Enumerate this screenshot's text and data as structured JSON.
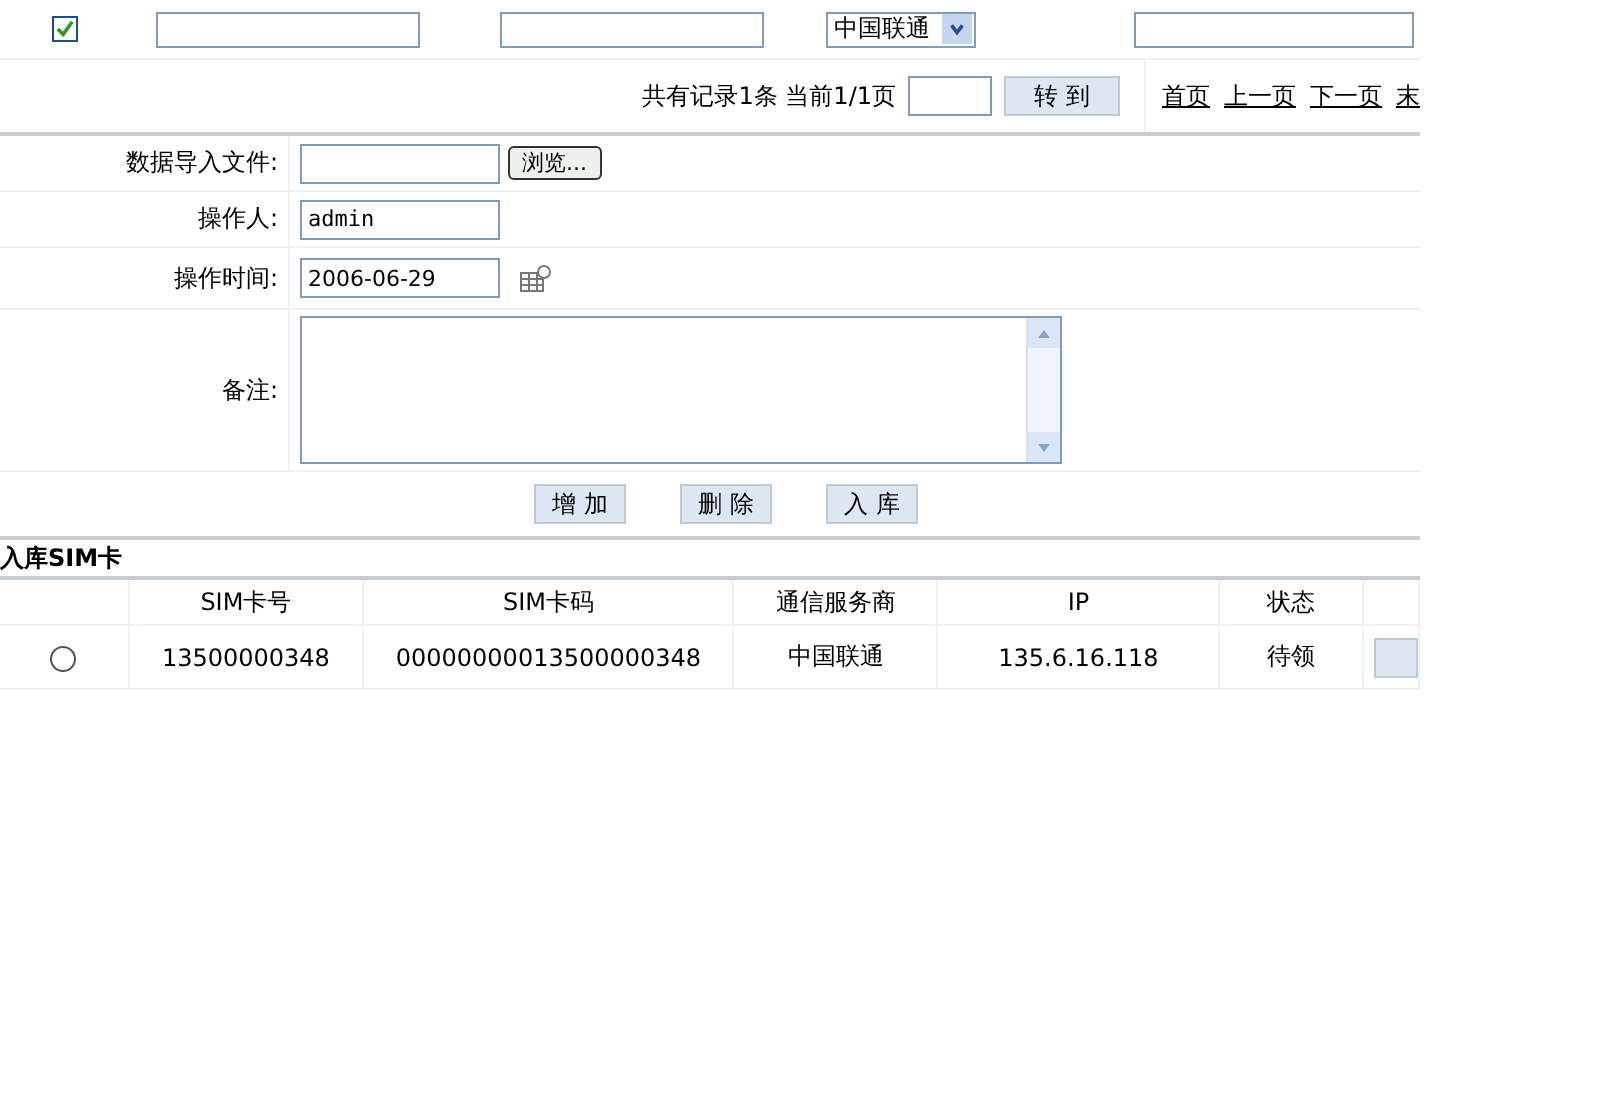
{
  "filter_row": {
    "checkbox_checked": true,
    "operator_select": "中国联通"
  },
  "pagination": {
    "summary": "共有记录1条 当前1/1页",
    "goto_button": "转 到",
    "links": [
      "首页",
      "上一页",
      "下一页",
      "末"
    ]
  },
  "form": {
    "fields": [
      {
        "kind": "file",
        "label": "数据导入文件:",
        "button": "浏览..."
      },
      {
        "kind": "text",
        "label": "操作人:",
        "value": "admin"
      },
      {
        "kind": "date",
        "label": "操作时间:",
        "value": "2006-06-29"
      },
      {
        "kind": "textarea",
        "label": "备注:"
      }
    ],
    "buttons": [
      "增 加",
      "删 除",
      "入 库"
    ]
  },
  "section_title": "入库SIM卡",
  "table": {
    "columns": [
      "SIM卡号",
      "SIM卡码",
      "通信服务商",
      "IP",
      "状态"
    ],
    "rows": [
      {
        "selected": false,
        "cells": [
          "13500000348",
          "00000000013500000348",
          "中国联通",
          "135.6.16.118",
          "待领"
        ]
      }
    ]
  }
}
